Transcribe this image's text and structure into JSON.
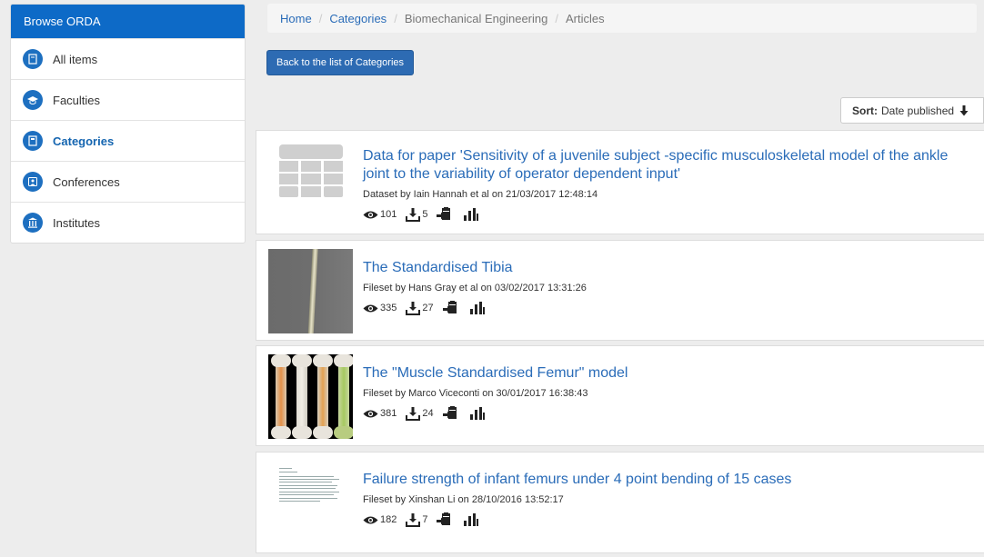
{
  "sidebar": {
    "header": "Browse ORDA",
    "items": [
      {
        "label": "All items",
        "icon": "document-icon",
        "active": false
      },
      {
        "label": "Faculties",
        "icon": "graduation-cap-icon",
        "active": false
      },
      {
        "label": "Categories",
        "icon": "folder-icon",
        "active": true
      },
      {
        "label": "Conferences",
        "icon": "presentation-icon",
        "active": false
      },
      {
        "label": "Institutes",
        "icon": "building-icon",
        "active": false
      }
    ]
  },
  "breadcrumb": {
    "home": "Home",
    "categories": "Categories",
    "category": "Biomechanical Engineering",
    "current": "Articles"
  },
  "back_button": "Back to the list of Categories",
  "sort": {
    "label": "Sort:",
    "value": "Date published"
  },
  "results": [
    {
      "title": "Data for paper 'Sensitivity of a juvenile subject -specific musculoskeletal model of the ankle joint to the variability of operator dependent input'",
      "meta": "Dataset by Iain Hannah et al on 21/03/2017 12:48:14",
      "views": "101",
      "downloads": "5",
      "thumbnail": "table-icon"
    },
    {
      "title": "The Standardised Tibia",
      "meta": "Fileset by Hans Gray et al on 03/02/2017 13:31:26",
      "views": "335",
      "downloads": "27",
      "thumbnail": "tibia-image"
    },
    {
      "title": "The \"Muscle Standardised Femur\" model",
      "meta": "Fileset by Marco Viceconti on 30/01/2017 16:38:43",
      "views": "381",
      "downloads": "24",
      "thumbnail": "femur-image"
    },
    {
      "title": "Failure strength of infant femurs under 4 point bending of 15 cases",
      "meta": "Fileset by Xinshan Li on 28/10/2016 13:52:17",
      "views": "182",
      "downloads": "7",
      "thumbnail": "document-preview"
    }
  ],
  "colors": {
    "accent": "#0d6ac7",
    "link": "#2a6cb8",
    "button": "#2d6bb3"
  }
}
